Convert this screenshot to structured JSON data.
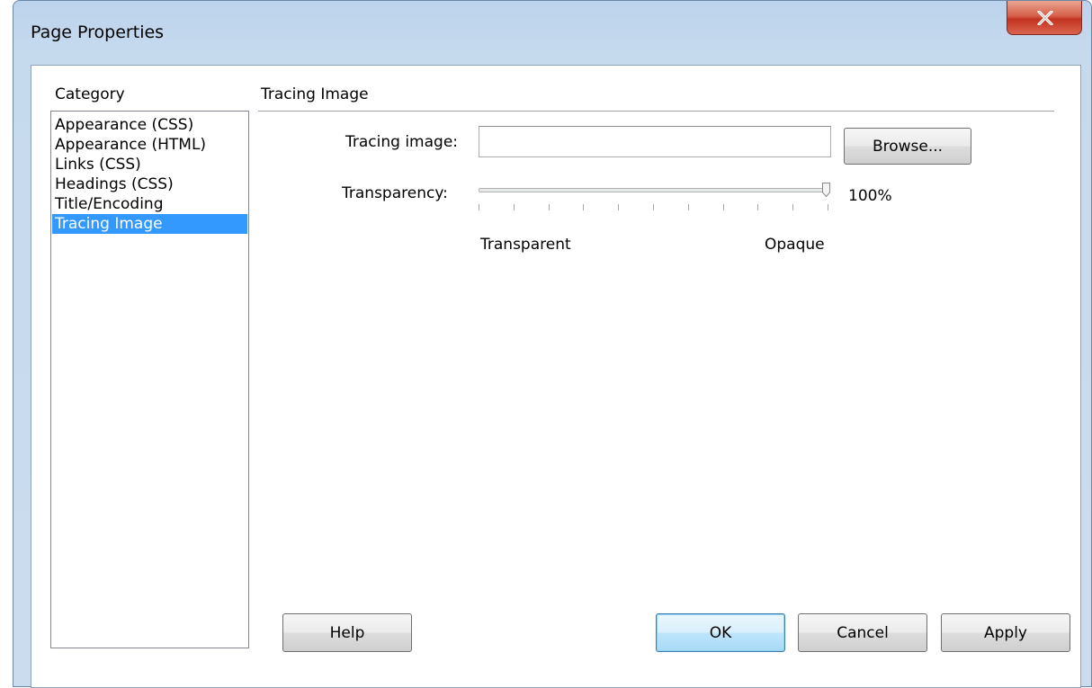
{
  "window": {
    "title": "Page Properties"
  },
  "category": {
    "label": "Category",
    "items": [
      {
        "label": "Appearance (CSS)",
        "selected": false
      },
      {
        "label": "Appearance (HTML)",
        "selected": false
      },
      {
        "label": "Links (CSS)",
        "selected": false
      },
      {
        "label": "Headings (CSS)",
        "selected": false
      },
      {
        "label": "Title/Encoding",
        "selected": false
      },
      {
        "label": "Tracing Image",
        "selected": true
      }
    ]
  },
  "panel": {
    "title": "Tracing Image",
    "tracing_image": {
      "label": "Tracing image:",
      "value": "",
      "placeholder": ""
    },
    "browse_label": "Browse...",
    "transparency": {
      "label": "Transparency:",
      "value_percent": 100,
      "value_text": "100%",
      "min_label": "Transparent",
      "max_label": "Opaque"
    }
  },
  "buttons": {
    "help": "Help",
    "ok": "OK",
    "cancel": "Cancel",
    "apply": "Apply"
  },
  "colors": {
    "selection": "#3399ff",
    "close_button": "#c7422c"
  }
}
